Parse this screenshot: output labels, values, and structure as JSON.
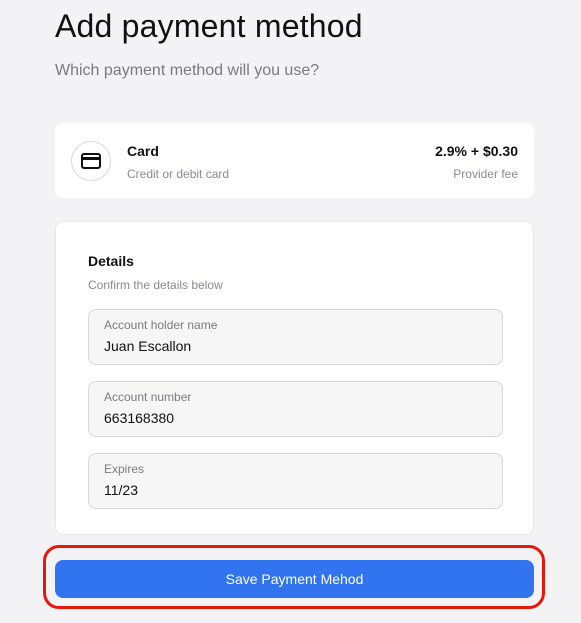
{
  "header": {
    "title": "Add payment method",
    "subtitle": "Which payment method will you use?"
  },
  "payment_method": {
    "icon": "credit-card-icon",
    "name": "Card",
    "description": "Credit or debit card",
    "fee": "2.9% + $0.30",
    "fee_label": "Provider fee"
  },
  "details": {
    "title": "Details",
    "subtitle": "Confirm the details below",
    "fields": [
      {
        "label": "Account holder name",
        "value": "Juan Escallon"
      },
      {
        "label": "Account number",
        "value": "663168380"
      },
      {
        "label": "Expires",
        "value": "11/23"
      }
    ]
  },
  "actions": {
    "save_label": "Save Payment Mehod"
  },
  "colors": {
    "accent": "#3273f0",
    "highlight": "#e8170c",
    "background": "#f3f3f5"
  }
}
